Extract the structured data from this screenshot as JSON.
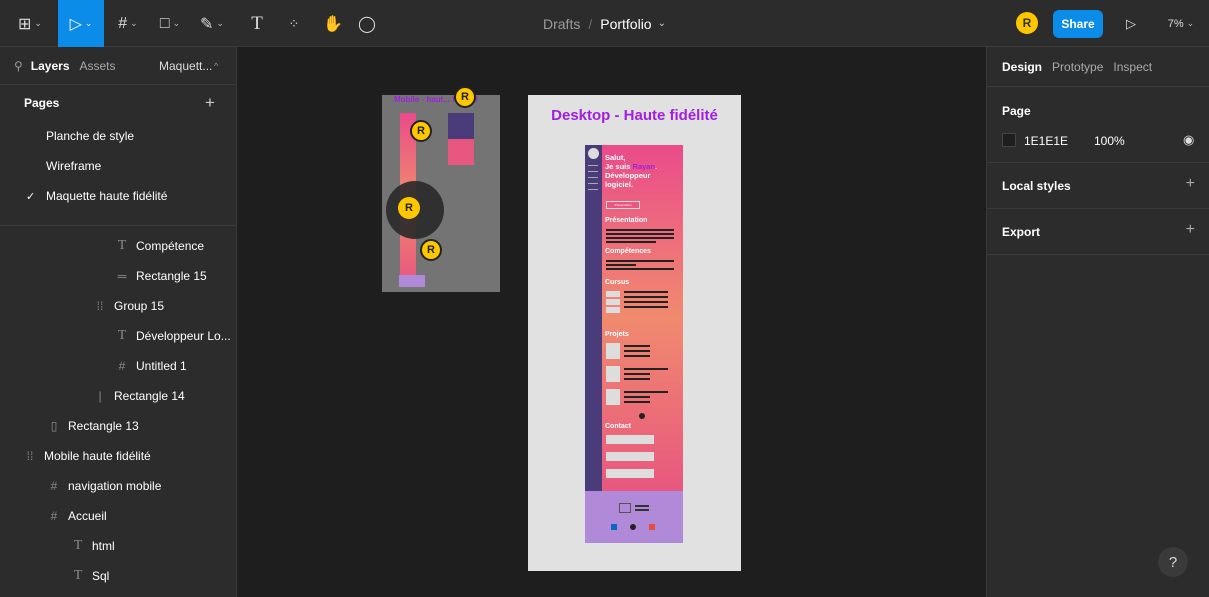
{
  "toolbar": {
    "breadcrumb_project": "Drafts",
    "breadcrumb_sep": "/",
    "file_name": "Portfolio",
    "avatar_initial": "R",
    "share_label": "Share",
    "zoom": "7%",
    "text_tool": "T"
  },
  "left_panel": {
    "tabs": [
      "Layers",
      "Assets",
      "Maquett..."
    ],
    "pages_header": "Pages",
    "pages": [
      "Planche de style",
      "Wireframe",
      "Maquette haute fidélité"
    ],
    "layers": [
      {
        "label": "Compétence",
        "icon": "text-icon"
      },
      {
        "label": "Rectangle 15",
        "icon": "line-icon"
      },
      {
        "label": "Group 15",
        "icon": "group-icon"
      },
      {
        "label": "Développeur Lo...",
        "icon": "text-icon"
      },
      {
        "label": "Untitled 1",
        "icon": "frame-icon"
      },
      {
        "label": "Rectangle 14",
        "icon": "rectangle-icon"
      },
      {
        "label": "Rectangle 13",
        "icon": "rectangle-icon"
      },
      {
        "label": "Mobile haute fidélité",
        "icon": "group-icon"
      },
      {
        "label": "navigation mobile",
        "icon": "frame-icon"
      },
      {
        "label": "Accueil",
        "icon": "frame-icon"
      },
      {
        "label": "html",
        "icon": "text-icon"
      },
      {
        "label": "Sql",
        "icon": "text-icon"
      }
    ]
  },
  "right_panel": {
    "tabs": [
      "Design",
      "Prototype",
      "Inspect"
    ],
    "page_title": "Page",
    "bg_color": "1E1E1E",
    "bg_opacity": "100%",
    "local_styles": "Local styles",
    "export": "Export"
  },
  "canvas": {
    "mobile_title": "Mobile - haut... fidélité",
    "desktop_title": "Desktop - Haute fidélité",
    "badge": "R",
    "site": {
      "hero_lines": [
        "Salut,",
        "Je suis ",
        "Rayan",
        ".",
        "Développeur",
        "logiciel."
      ],
      "hero_button": "Présentation",
      "sections": [
        "Présentation",
        "Compétences",
        "Cursus",
        "Projets",
        "Contact"
      ]
    }
  },
  "help_label": "?",
  "colors": {
    "accent": "#0c8ce9",
    "title": "#a11ee0",
    "avatar": "#ffc700"
  }
}
